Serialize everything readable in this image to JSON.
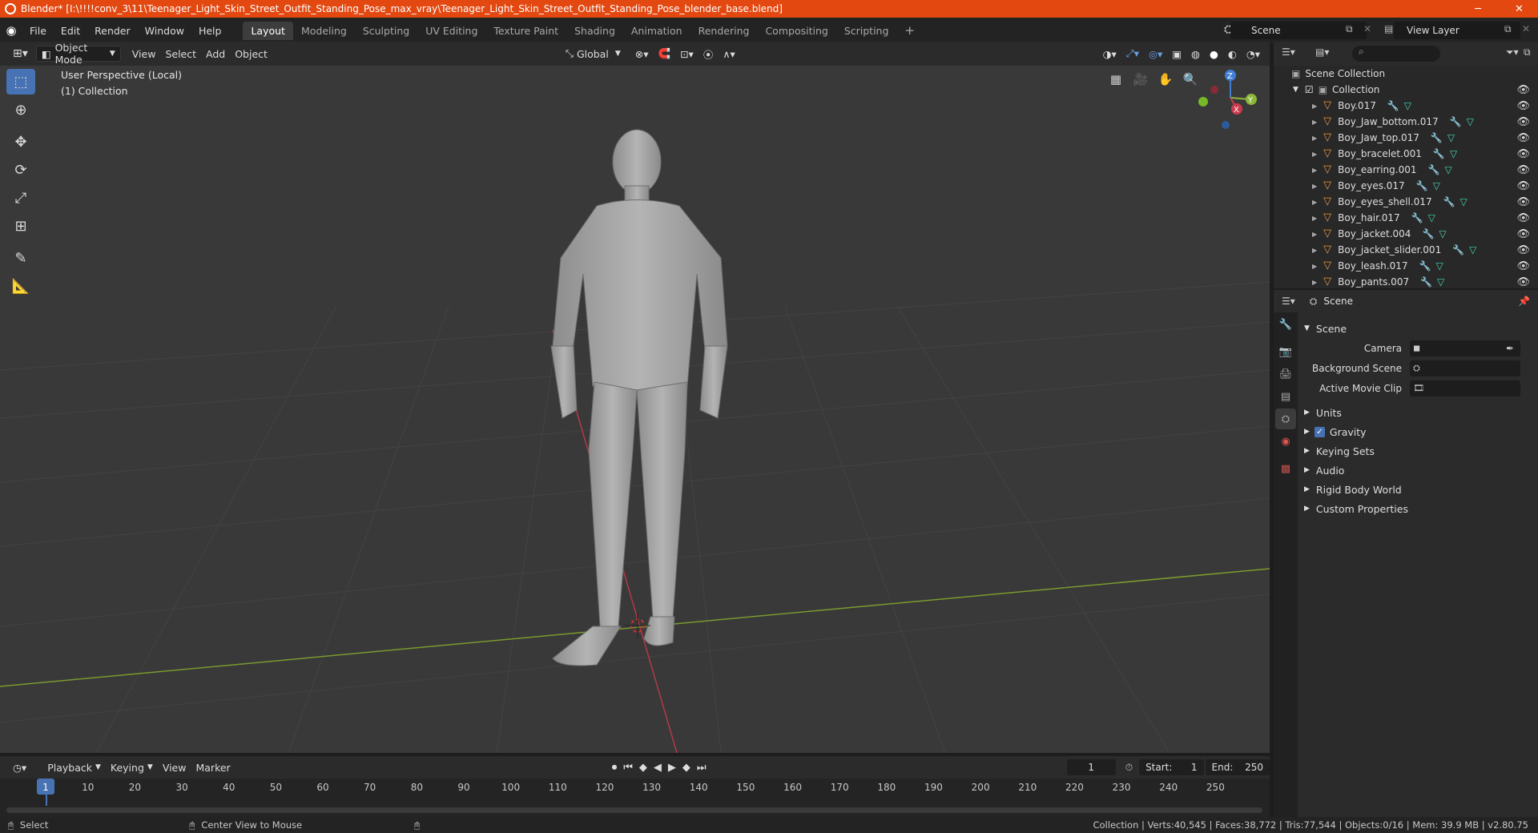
{
  "window": {
    "title": "Blender* [I:\\!!!!conv_3\\11\\Teenager_Light_Skin_Street_Outfit_Standing_Pose_max_vray\\Teenager_Light_Skin_Street_Outfit_Standing_Pose_blender_base.blend]",
    "minimize": "─",
    "maximize": "❐",
    "close": "✕"
  },
  "menu": [
    "File",
    "Edit",
    "Render",
    "Window",
    "Help"
  ],
  "workspaces": [
    "Layout",
    "Modeling",
    "Sculpting",
    "UV Editing",
    "Texture Paint",
    "Shading",
    "Animation",
    "Rendering",
    "Compositing",
    "Scripting"
  ],
  "workspace_add": "+",
  "scene_field": "Scene",
  "view_layer_field": "View Layer",
  "viewport_header": {
    "mode": "Object Mode",
    "menus": [
      "View",
      "Select",
      "Add",
      "Object"
    ],
    "orientation": "Global"
  },
  "viewport": {
    "perspective": "User Perspective (Local)",
    "collection": "(1) Collection",
    "gizmo": {
      "z": "Z",
      "y": "Y",
      "x": "X"
    }
  },
  "outliner": {
    "search_placeholder": "",
    "root": "Scene Collection",
    "collection": "Collection",
    "objects": [
      "Boy.017",
      "Boy_Jaw_bottom.017",
      "Boy_Jaw_top.017",
      "Boy_bracelet.001",
      "Boy_earring.001",
      "Boy_eyes.017",
      "Boy_eyes_shell.017",
      "Boy_hair.017",
      "Boy_jacket.004",
      "Boy_jacket_slider.001",
      "Boy_leash.017",
      "Boy_pants.007"
    ]
  },
  "properties": {
    "context": "Scene",
    "panel": "Scene",
    "fields": [
      {
        "label": "Camera",
        "value": ""
      },
      {
        "label": "Background Scene",
        "value": ""
      },
      {
        "label": "Active Movie Clip",
        "value": ""
      }
    ],
    "subpanels": [
      "Units",
      "Gravity",
      "Keying Sets",
      "Audio",
      "Rigid Body World",
      "Custom Properties"
    ],
    "gravity_checked": true
  },
  "timeline": {
    "menus": [
      "Playback",
      "Keying",
      "View",
      "Marker"
    ],
    "current_frame": "1",
    "start_label": "Start:",
    "start": "1",
    "end_label": "End:",
    "end": "250",
    "ticks": [
      "1",
      "10",
      "20",
      "30",
      "40",
      "50",
      "60",
      "70",
      "80",
      "90",
      "100",
      "110",
      "120",
      "130",
      "140",
      "150",
      "160",
      "170",
      "180",
      "190",
      "200",
      "210",
      "220",
      "230",
      "240",
      "250"
    ]
  },
  "status": {
    "left_action": "Select",
    "middle_action": "Center View to Mouse",
    "stats": "Collection | Verts:40,545 | Faces:38,772 | Tris:77,544 | Objects:0/16 | Mem: 39.9 MB | v2.80.75"
  },
  "colors": {
    "title_bar": "#e34811",
    "active_tool": "#4772b3",
    "x_axis": "#c93b4d",
    "y_axis": "#8cb83a",
    "z_axis": "#3f7fd6"
  }
}
